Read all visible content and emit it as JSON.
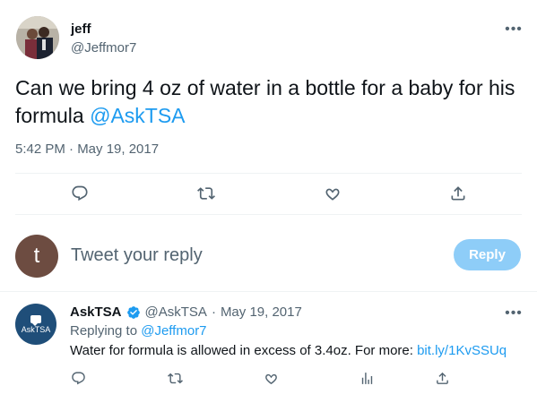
{
  "tweet": {
    "author_name": "jeff",
    "author_handle": "@Jeffmor7",
    "text": "Can we bring 4 oz of water in a bottle for a baby for his formula ",
    "mention": "@AskTSA",
    "timestamp": "5:42 PM · May 19, 2017",
    "more_icon": "ellipsis-icon"
  },
  "actions": {
    "reply_icon": "reply-icon",
    "retweet_icon": "retweet-icon",
    "like_icon": "like-icon",
    "share_icon": "share-icon"
  },
  "composer": {
    "avatar_letter": "t",
    "placeholder": "Tweet your reply",
    "reply_button": "Reply",
    "reply_button_color": "#8ecdf8"
  },
  "reply_tweet": {
    "author_name": "AskTSA",
    "author_handle": "@AskTSA",
    "separator": "·",
    "date": "May 19, 2017",
    "avatar_text": "AskTSA",
    "replying_to_label": "Replying to ",
    "replying_to_handle": "@Jeffmor7",
    "text": "Water for formula is allowed in excess of 3.4oz. For more: ",
    "link": "bit.ly/1KvSSUq"
  },
  "colors": {
    "accent": "#1d9bf0",
    "secondary_text": "#536471",
    "divider": "#eff3f4"
  }
}
